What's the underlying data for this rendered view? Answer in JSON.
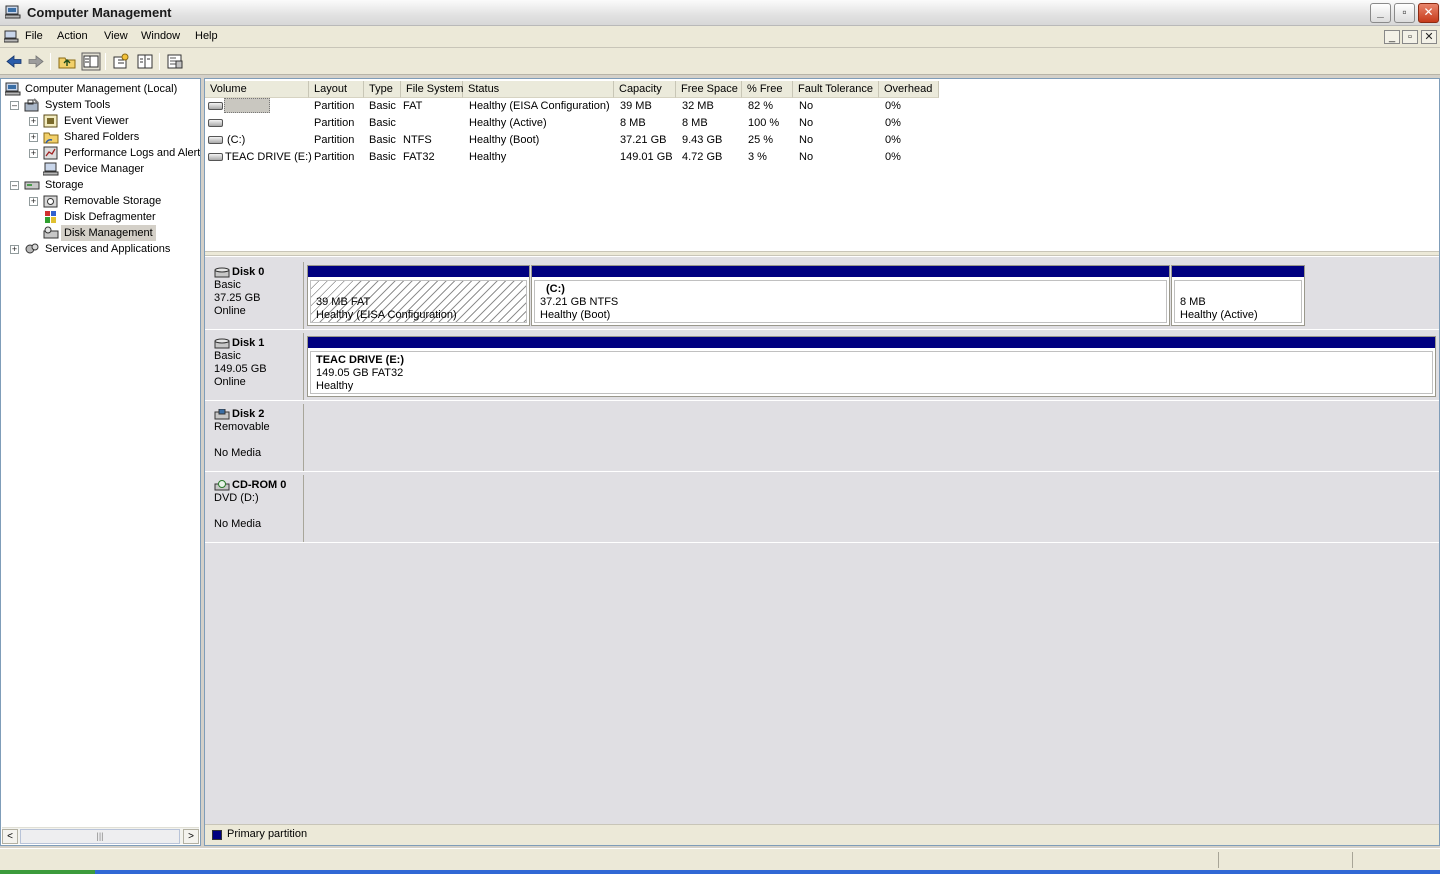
{
  "window": {
    "title": "Computer Management",
    "minimize": "_",
    "maximize": "▫",
    "close": "✕"
  },
  "menu": {
    "items": [
      "File",
      "Action",
      "View",
      "Window",
      "Help"
    ]
  },
  "tree": {
    "root": "Computer Management (Local)",
    "system_tools": "System Tools",
    "event_viewer": "Event Viewer",
    "shared_folders": "Shared Folders",
    "perf_logs": "Performance Logs and Alerts",
    "device_manager": "Device Manager",
    "storage": "Storage",
    "removable_storage": "Removable Storage",
    "disk_defragmenter": "Disk Defragmenter",
    "disk_management": "Disk Management",
    "services": "Services and Applications"
  },
  "list": {
    "headers": [
      "Volume",
      "Layout",
      "Type",
      "File System",
      "Status",
      "Capacity",
      "Free Space",
      "% Free",
      "Fault Tolerance",
      "Overhead"
    ],
    "rows": [
      [
        "",
        "Partition",
        "Basic",
        "FAT",
        "Healthy (EISA Configuration)",
        "39 MB",
        "32 MB",
        "82 %",
        "No",
        "0%"
      ],
      [
        "",
        "Partition",
        "Basic",
        "",
        "Healthy (Active)",
        "8 MB",
        "8 MB",
        "100 %",
        "No",
        "0%"
      ],
      [
        "(C:)",
        "Partition",
        "Basic",
        "NTFS",
        "Healthy (Boot)",
        "37.21 GB",
        "9.43 GB",
        "25 %",
        "No",
        "0%"
      ],
      [
        "TEAC DRIVE (E:)",
        "Partition",
        "Basic",
        "FAT32",
        "Healthy",
        "149.01 GB",
        "4.72 GB",
        "3 %",
        "No",
        "0%"
      ]
    ]
  },
  "disks": [
    {
      "name": "Disk 0",
      "line1": "Basic",
      "line2": "37.25 GB",
      "line3": "Online",
      "partitions": [
        {
          "title": "",
          "size": "39 MB FAT",
          "status": "Healthy (EISA Configuration)"
        },
        {
          "title": "(C:)",
          "size": "37.21 GB NTFS",
          "status": "Healthy (Boot)"
        },
        {
          "title": "",
          "size": "8 MB",
          "status": "Healthy (Active)"
        }
      ]
    },
    {
      "name": "Disk 1",
      "line1": "Basic",
      "line2": "149.05 GB",
      "line3": "Online",
      "partitions": [
        {
          "title": "TEAC DRIVE  (E:)",
          "size": "149.05 GB FAT32",
          "status": "Healthy"
        }
      ]
    },
    {
      "name": "Disk 2",
      "line1": "Removable",
      "line2": "",
      "line3": "No Media",
      "partitions": []
    },
    {
      "name": "CD-ROM 0",
      "line1": "DVD (D:)",
      "line2": "",
      "line3": "No Media",
      "partitions": []
    }
  ],
  "legend": {
    "primary": "Primary partition",
    "primary_color": "#000080"
  },
  "scroll": {
    "left": "<",
    "right": ">",
    "grip": "|||"
  }
}
